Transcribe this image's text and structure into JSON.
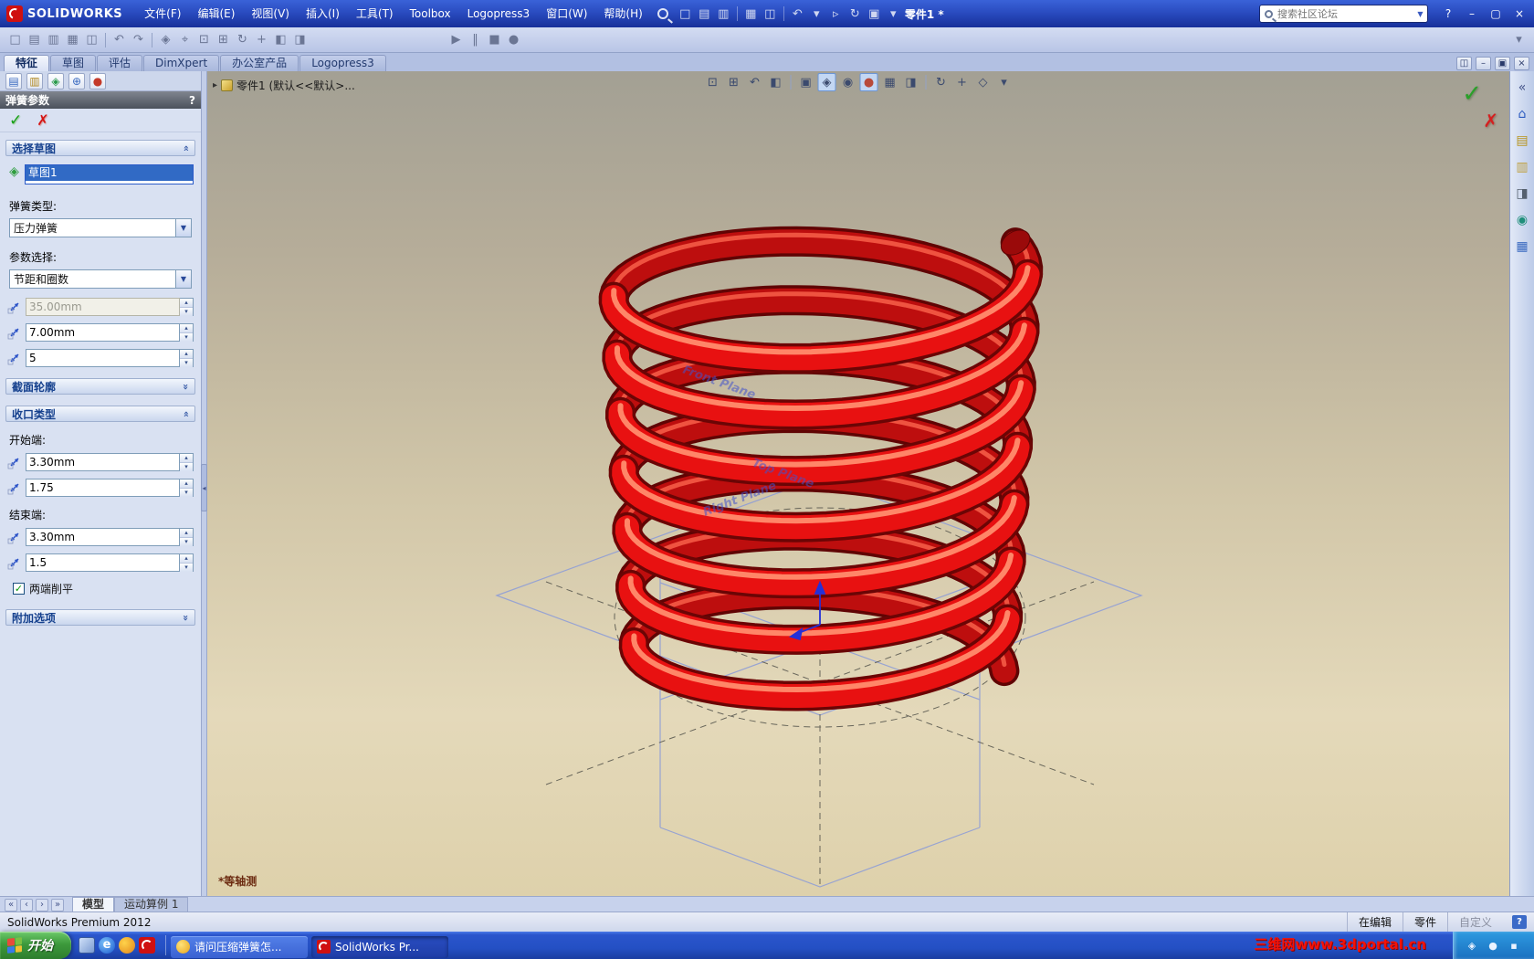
{
  "glyphs": {
    "check": "✓",
    "cross": "✗"
  },
  "colors": {
    "spring_red": "#e81111",
    "spring_dark": "#6b0505",
    "plane_blue": "#8b9bd8",
    "titlebar_blue": "#2a4cc0",
    "taskbar_blue": "#2450c4",
    "start_green": "#3d9a3c",
    "selection_blue": "#316ac5"
  },
  "window": {
    "brand": "SOLIDWORKS",
    "menus": [
      "文件(F)",
      "编辑(E)",
      "视图(V)",
      "插入(I)",
      "工具(T)",
      "Toolbox",
      "Logopress3",
      "窗口(W)",
      "帮助(H)"
    ],
    "doc_title": "零件1 *",
    "search_placeholder": "搜索社区论坛",
    "controls": {
      "help": "?",
      "min": "–",
      "max": "▢",
      "close": "×"
    },
    "title_toolbar_icons": [
      {
        "n": "new-doc",
        "g": "□"
      },
      {
        "n": "open-doc",
        "g": "▤"
      },
      {
        "n": "save-doc",
        "g": "▥"
      },
      {
        "sep": true
      },
      {
        "n": "print-doc",
        "g": "▦"
      },
      {
        "n": "print-preview",
        "g": "◫"
      },
      {
        "sep": true
      },
      {
        "n": "undo",
        "g": "↶"
      },
      {
        "n": "undo-list",
        "g": "▾"
      },
      {
        "n": "select-tool",
        "g": "▹"
      },
      {
        "n": "rebuild",
        "g": "↻"
      },
      {
        "n": "file-properties",
        "g": "▣"
      },
      {
        "n": "options",
        "g": "▾"
      }
    ],
    "std_toolbar_icons": [
      {
        "n": "new-file",
        "g": "□"
      },
      {
        "n": "open-file",
        "g": "▤"
      },
      {
        "n": "save-file",
        "g": "▥"
      },
      {
        "n": "print-file",
        "g": "▦"
      },
      {
        "n": "print-preview2",
        "g": "◫"
      },
      {
        "sep": true
      },
      {
        "n": "undo2",
        "g": "↶"
      },
      {
        "n": "redo",
        "g": "↷"
      },
      {
        "sep": true
      },
      {
        "n": "sketch-tool",
        "g": "◈"
      },
      {
        "n": "smart-dimension",
        "g": "⌖"
      },
      {
        "n": "zoom-to-fit",
        "g": "⊡"
      },
      {
        "n": "zoom-to-area",
        "g": "⊞"
      },
      {
        "n": "rotate-view-tool",
        "g": "↻"
      },
      {
        "n": "pan-tool",
        "g": "+"
      },
      {
        "n": "shaded-view",
        "g": "◧"
      },
      {
        "n": "section-tool",
        "g": "◨"
      }
    ],
    "std_toolbar_mid": [
      {
        "n": "macro-run",
        "g": "▶"
      },
      {
        "n": "macro-pause",
        "g": "‖"
      },
      {
        "n": "macro-stop",
        "g": "■"
      },
      {
        "n": "macro-record",
        "g": "●"
      }
    ],
    "toolbar_options_glyph": "▾"
  },
  "command_tabs": {
    "items": [
      "特征",
      "草图",
      "评估",
      "DimXpert",
      "办公室产品",
      "Logopress3"
    ],
    "active_index": 0
  },
  "pm": {
    "tab_icons": [
      {
        "n": "pm-property-tab",
        "g": "▤",
        "c": "#3a6ac0"
      },
      {
        "n": "pm-configuration-tab",
        "g": "▥",
        "c": "#b08820"
      },
      {
        "n": "pm-display-tab",
        "g": "◈",
        "c": "#2a9a4a"
      },
      {
        "n": "pm-dimxpert-tab",
        "g": "⊕",
        "c": "#3a6ac0"
      },
      {
        "n": "pm-appearance-tab",
        "g": "●",
        "c": "#c43a2a"
      }
    ],
    "title": "弹簧参数",
    "help": "?",
    "groups": {
      "select_sketch": "选择草图",
      "profile": "截面轮廓",
      "ends": "收口类型",
      "extra": "附加选项"
    },
    "sketch_selection": "草图1",
    "spring_type_label": "弹簧类型:",
    "spring_type": "压力弹簧",
    "param_label": "参数选择:",
    "param": "节距和圈数",
    "free_length": "35.00mm",
    "pitch": "7.00mm",
    "coils": "5",
    "start_label": "开始端:",
    "start_pitch": "3.30mm",
    "start_turns": "1.75",
    "end_label": "结束端:",
    "end_pitch": "3.30mm",
    "end_turns": "1.5",
    "flatten": "两端削平"
  },
  "viewport": {
    "tree_item": "零件1 (默认<<默认>...",
    "view_label": "*等轴测",
    "planes": {
      "front": "Front Plane",
      "top": "Top Plane",
      "right": "Right Plane"
    },
    "headsup_icons": [
      {
        "n": "zoom-fit",
        "g": "⊡"
      },
      {
        "n": "zoom-area",
        "g": "⊞"
      },
      {
        "n": "previous-view",
        "g": "↶"
      },
      {
        "n": "section-view",
        "g": "◧"
      },
      {
        "sep": true
      },
      {
        "n": "view-orientation",
        "g": "▣"
      },
      {
        "n": "display-style",
        "g": "◈",
        "p": true
      },
      {
        "n": "hide-show-items",
        "g": "◉"
      },
      {
        "n": "edit-appearance",
        "g": "●",
        "c": "#b84a3a",
        "p": true
      },
      {
        "n": "apply-scene",
        "g": "▦"
      },
      {
        "n": "view-settings",
        "g": "◨"
      },
      {
        "sep": true
      },
      {
        "n": "rotate-view",
        "g": "↻"
      },
      {
        "n": "pan-view",
        "g": "+"
      },
      {
        "n": "3d-drawing-view",
        "g": "◇"
      },
      {
        "n": "headsup-expand",
        "g": "▾"
      }
    ],
    "doc_controls": [
      {
        "n": "viewport-split",
        "g": "◫"
      },
      {
        "n": "doc-minimize",
        "g": "–"
      },
      {
        "n": "doc-restore",
        "g": "▣"
      },
      {
        "n": "doc-close",
        "g": "×"
      }
    ]
  },
  "task_pane_icons": [
    {
      "n": "taskpane-expand",
      "g": "«",
      "c": "#44548a"
    },
    {
      "n": "sw-resources",
      "g": "⌂",
      "c": "#2a5ac0"
    },
    {
      "n": "design-library",
      "g": "▤",
      "c": "#b8941e"
    },
    {
      "n": "file-explorer",
      "g": "▥",
      "c": "#c0a040"
    },
    {
      "n": "view-palette",
      "g": "◨",
      "c": "#55606e"
    },
    {
      "n": "appearances",
      "g": "◉",
      "c": "#1f8f7a"
    },
    {
      "n": "custom-properties",
      "g": "▦",
      "c": "#3a6ac0"
    }
  ],
  "bottom": {
    "nav_icons": [
      {
        "n": "tab-scroll-first",
        "g": "«"
      },
      {
        "n": "tab-scroll-prev",
        "g": "‹"
      },
      {
        "n": "tab-scroll-next",
        "g": "›"
      },
      {
        "n": "tab-scroll-last",
        "g": "»"
      }
    ],
    "tabs": [
      "模型",
      "运动算例 1"
    ],
    "active_index": 0
  },
  "status": {
    "left": "SolidWorks Premium 2012",
    "editing": "在编辑",
    "doc": "零件",
    "custom": "自定义",
    "help": "?"
  },
  "taskbar": {
    "start": "开始",
    "items": [
      {
        "label": "请问压缩弹簧怎...",
        "active": false
      },
      {
        "label": "SolidWorks Pr...",
        "active": true
      }
    ],
    "tray_icons": [
      {
        "n": "tray-status-1",
        "g": "◈"
      },
      {
        "n": "tray-status-2",
        "g": "●"
      },
      {
        "n": "tray-status-3",
        "g": "▪"
      }
    ],
    "watermark": "三维网www.3dportal.cn"
  }
}
